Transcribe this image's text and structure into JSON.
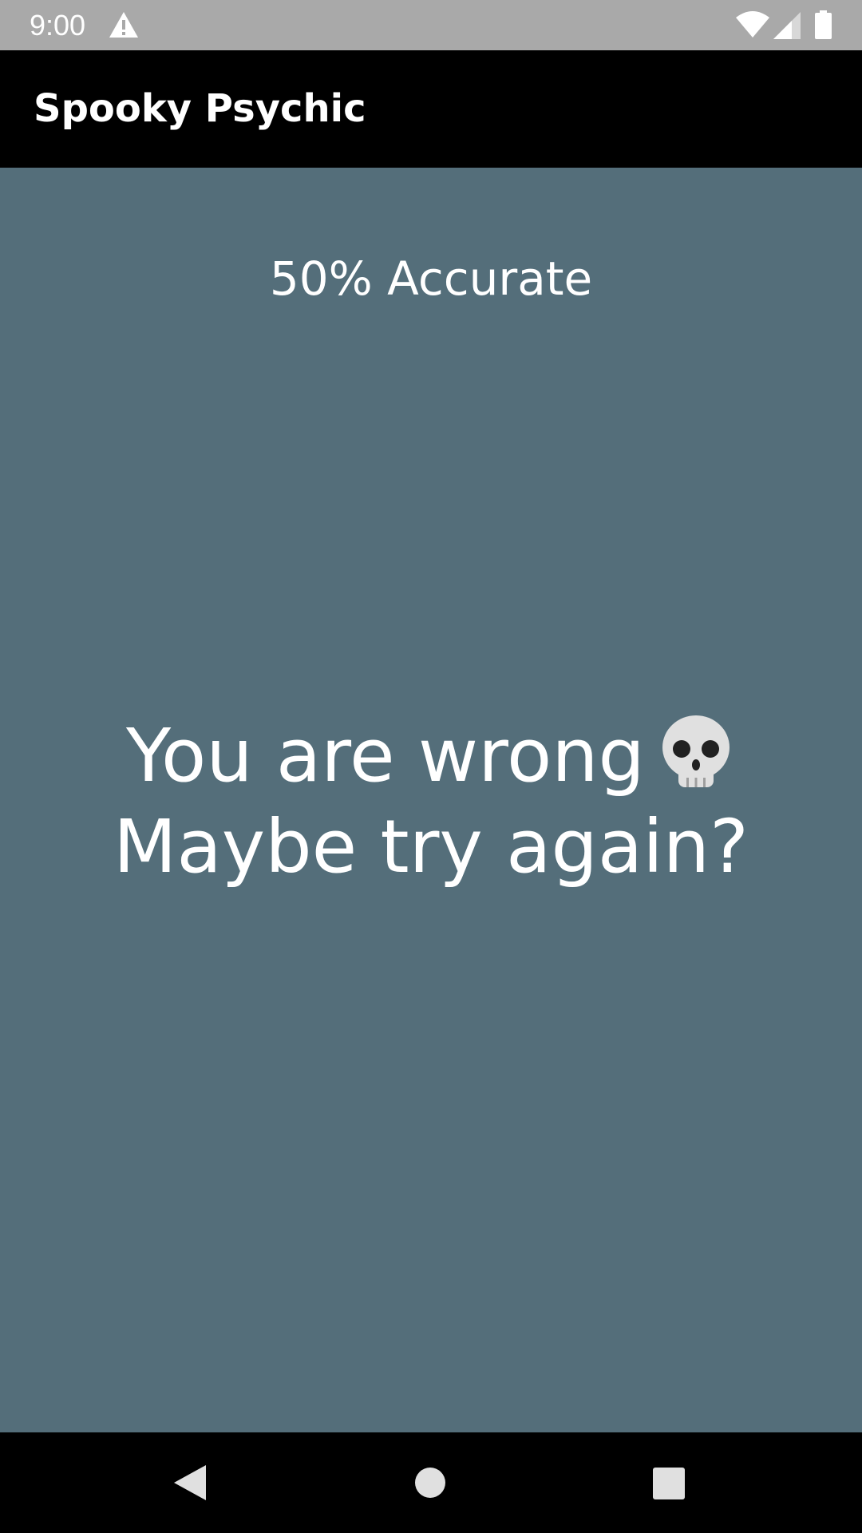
{
  "status_bar": {
    "time": "9:00",
    "icons": [
      "warning-icon",
      "wifi-icon",
      "cell-signal-icon",
      "battery-icon"
    ]
  },
  "app_bar": {
    "title": "Spooky Psychic"
  },
  "main": {
    "accuracy_text": "50% Accurate",
    "result_line_1": "You are wrong",
    "result_emoji_icon": "skull-icon",
    "result_line_2": "Maybe try again?"
  },
  "nav_bar": {
    "icons": [
      "back-icon",
      "home-icon",
      "recents-icon"
    ]
  },
  "colors": {
    "background": "#546e7a",
    "status_bar": "#a9a9a9",
    "app_bar": "#000000",
    "text": "#ffffff"
  }
}
